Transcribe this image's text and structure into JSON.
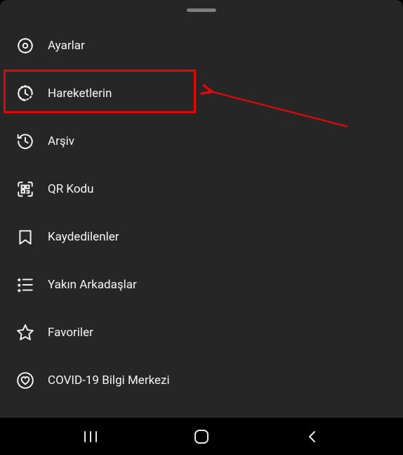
{
  "menu": {
    "items": [
      {
        "label": "Ayarlar",
        "icon": "gear-icon"
      },
      {
        "label": "Hareketlerin",
        "icon": "activity-icon"
      },
      {
        "label": "Arşiv",
        "icon": "archive-icon"
      },
      {
        "label": "QR Kodu",
        "icon": "qr-icon"
      },
      {
        "label": "Kaydedilenler",
        "icon": "bookmark-icon"
      },
      {
        "label": "Yakın Arkadaşlar",
        "icon": "close-friends-icon"
      },
      {
        "label": "Favoriler",
        "icon": "star-icon"
      },
      {
        "label": "COVID-19 Bilgi Merkezi",
        "icon": "heart-circle-icon"
      }
    ]
  },
  "annotation": {
    "highlighted_index": 1,
    "color": "#e10808"
  }
}
